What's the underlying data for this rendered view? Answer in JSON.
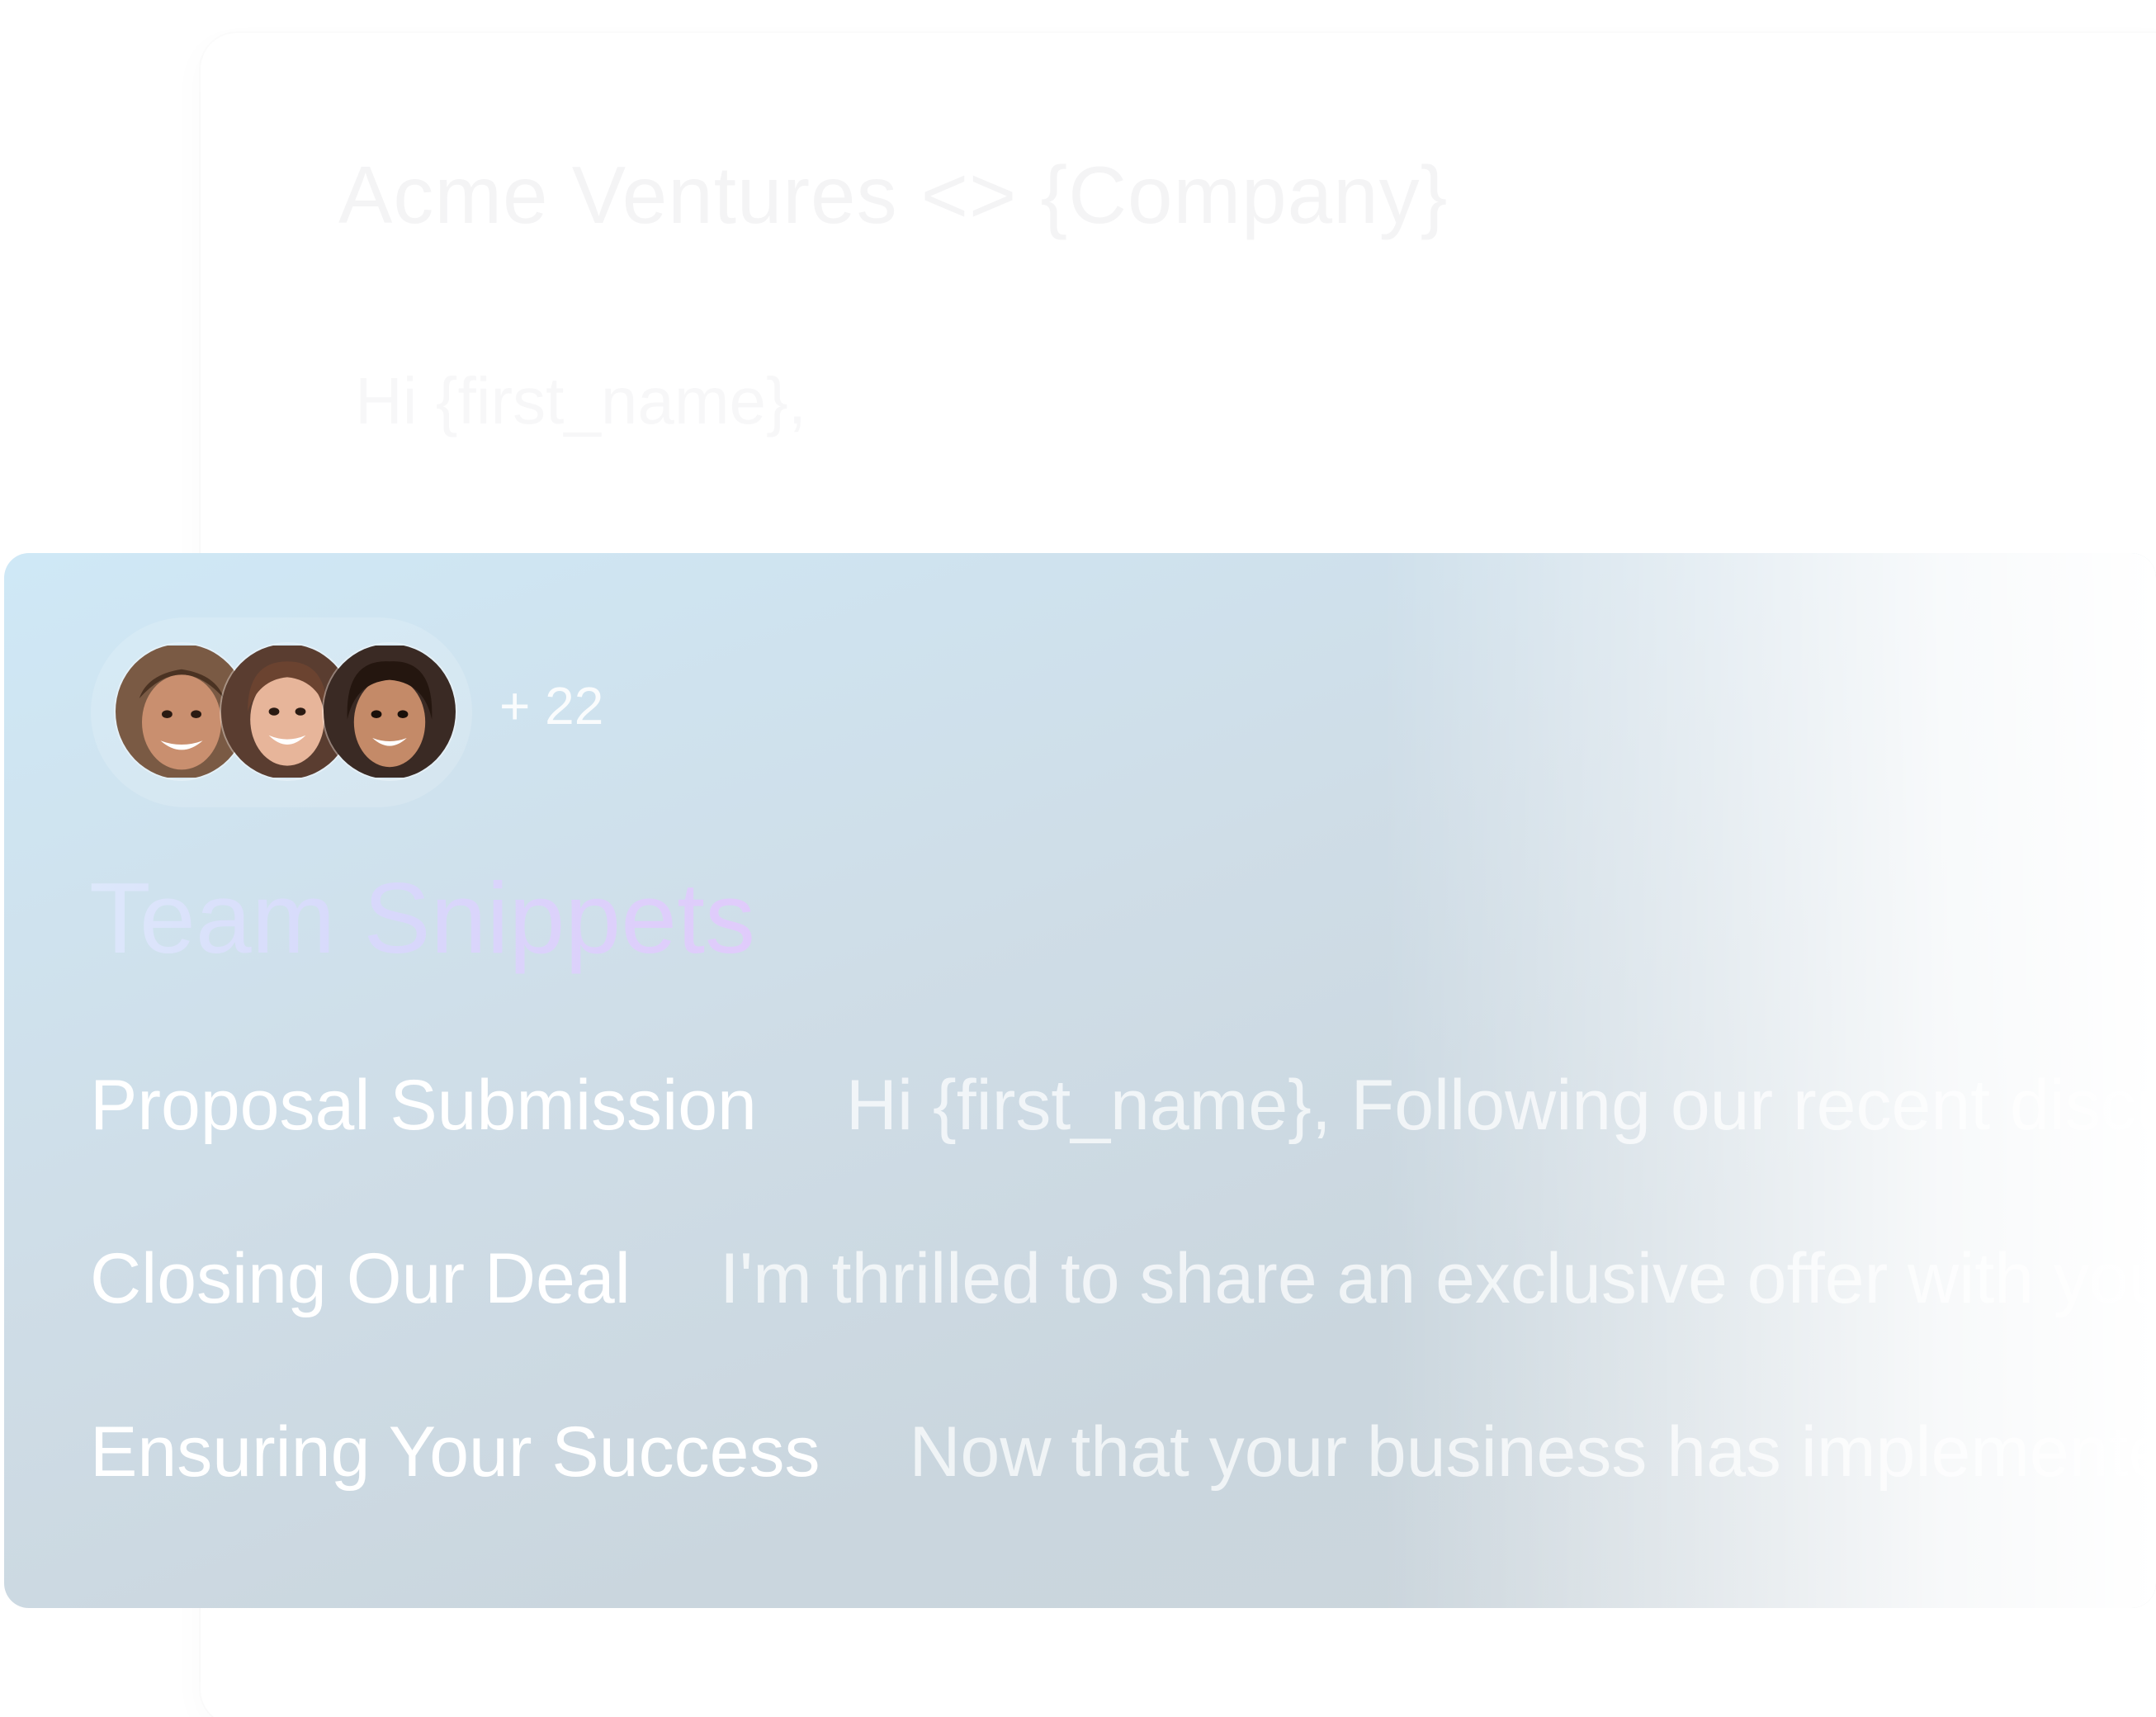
{
  "email_card": {
    "subject": "Acme Ventures <> {Company}",
    "preview_line": "Hi {first_name},"
  },
  "team_snippets": {
    "members_extra_count": "+ 22",
    "avatars": [
      "member-1",
      "member-2",
      "member-3"
    ],
    "title": "Team Snippets",
    "items": [
      {
        "name": "Proposal Submission",
        "preview": "Hi {first_name}, Following our recent discussion"
      },
      {
        "name": "Closing Our Deal",
        "preview": "I'm thrilled to share an exclusive offer with you"
      },
      {
        "name": "Ensuring Your Success",
        "preview": "Now that your business has implemented"
      }
    ]
  },
  "colors": {
    "panel_start": "#cfe8f6",
    "panel_end": "#ccd5db",
    "title_start": "#dde8fb",
    "title_end": "#e0cbfb"
  }
}
